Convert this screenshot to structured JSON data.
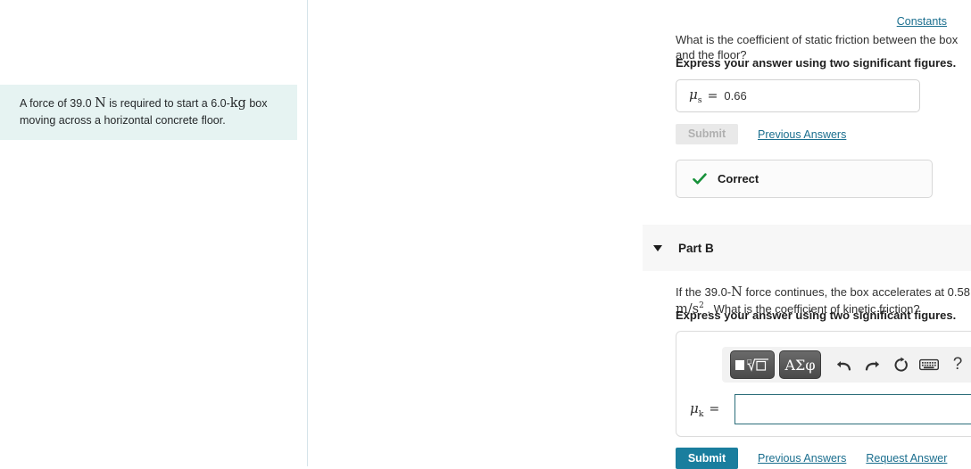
{
  "constants": {
    "label": "Constants"
  },
  "problem": {
    "text_before_force": "A force of 39.0",
    "force_unit": "N",
    "text_middle": "is required to start a 6.0-",
    "mass_unit": "kg",
    "text_after": "box moving across a horizontal concrete floor."
  },
  "part_a": {
    "question": "What is the coefficient of static friction between the box and the floor?",
    "instruction": "Express your answer using two significant figures.",
    "variable": "μ",
    "subscript": "s",
    "equals": "=",
    "value": "0.66",
    "submit_label": "Submit",
    "previous_answers_label": "Previous Answers",
    "feedback": "Correct",
    "feedback_icon": "check-icon",
    "feedback_color": "#17913a"
  },
  "part_b": {
    "title": "Part B",
    "caret_icon": "chevron-down-icon",
    "question_part1": "If the 39.0-",
    "question_unit1": "N",
    "question_part2": "force continues, the box accelerates at 0.58",
    "question_unit2": "m/s",
    "question_unit2_exp": "2",
    "question_part3": ". What is the coefficient of kinetic friction?",
    "instruction": "Express your answer using two significant figures.",
    "variable": "μ",
    "subscript": "k",
    "equals": "=",
    "input_value": "",
    "input_placeholder": "",
    "toolbar": {
      "template_button": "template-radical-button",
      "greek_button": "ΑΣφ",
      "undo_icon": "undo-arrow-icon",
      "redo_icon": "redo-arrow-icon",
      "reset_icon": "reset-circle-icon",
      "keyboard_icon": "keyboard-icon",
      "help_icon": "?"
    },
    "submit_label": "Submit",
    "previous_answers_label": "Previous Answers",
    "request_answer_label": "Request Answer"
  },
  "colors": {
    "accent": "#1a7e9e",
    "link": "#1a6e8e",
    "success": "#17913a",
    "problem_bg": "#e6f3f2",
    "panel_bg": "#f7f7f7"
  }
}
